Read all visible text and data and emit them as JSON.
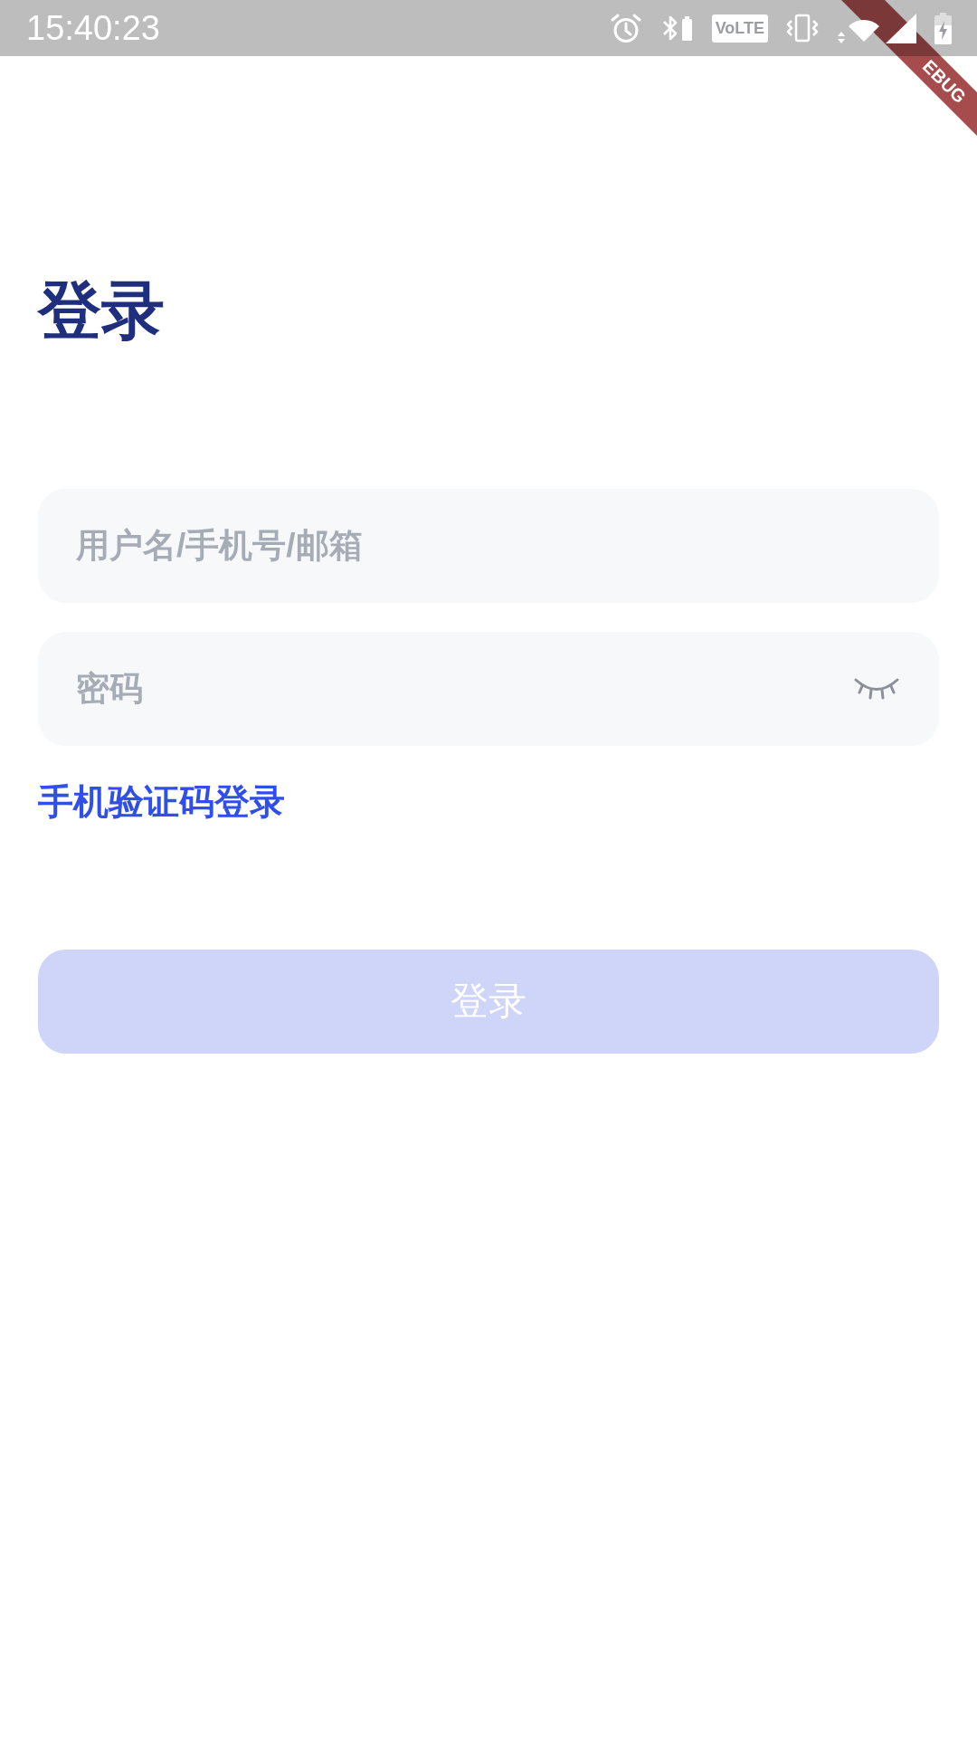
{
  "status_bar": {
    "time": "15:40:23",
    "network_badge": "VoLTE"
  },
  "debug_banner": {
    "label": "EBUG"
  },
  "title": "登录",
  "form": {
    "fields": [
      {
        "kind": "text",
        "placeholder": "用户名/手机号/邮箱"
      },
      {
        "kind": "password",
        "placeholder": "密码",
        "obscured": true
      }
    ],
    "alt_login_link": "手机验证码登录",
    "submit": {
      "label": "登录",
      "disabled": true
    }
  }
}
